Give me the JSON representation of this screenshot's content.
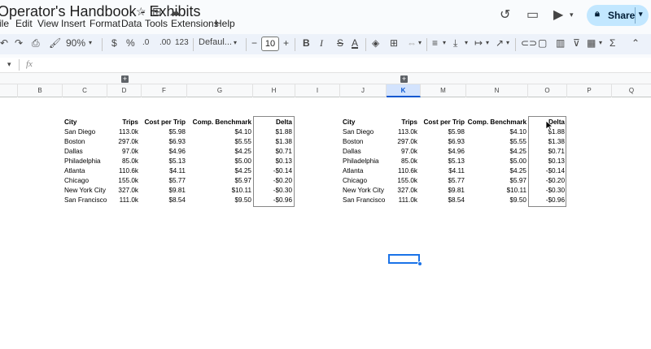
{
  "doc": {
    "title": "Operator's Handbook - Exhibits"
  },
  "menu": [
    "File",
    "Edit",
    "View",
    "Insert",
    "Format",
    "Data",
    "Tools",
    "Extensions",
    "Help"
  ],
  "menu_display": [
    "ile",
    "Edit",
    "View",
    "Insert",
    "Format",
    "Data",
    "Tools",
    "Extensions",
    "Help"
  ],
  "share": {
    "label": "Share"
  },
  "toolbar": {
    "zoom": "90%",
    "currency": "$",
    "percent": "%",
    "dec_decrease": ".0",
    "dec_increase": ".00",
    "format_123": "123",
    "font": "Defaul...",
    "font_size": "10",
    "minus": "−",
    "plus": "+",
    "bold": "B",
    "italic": "I",
    "strike": "S",
    "text_color": "A",
    "sigma": "Σ"
  },
  "formula": {
    "fx": "fx"
  },
  "columns": [
    "B",
    "C",
    "D",
    "F",
    "G",
    "H",
    "I",
    "J",
    "K",
    "M",
    "N",
    "O",
    "P",
    "Q"
  ],
  "table": {
    "headers": [
      "City",
      "Trips",
      "Cost per Trip",
      "Comp. Benchmark",
      "Delta"
    ],
    "rows": [
      [
        "San Diego",
        "113.0k",
        "$5.98",
        "$4.10",
        "$1.88"
      ],
      [
        "Boston",
        "297.0k",
        "$6.93",
        "$5.55",
        "$1.38"
      ],
      [
        "Dallas",
        "97.0k",
        "$4.96",
        "$4.25",
        "$0.71"
      ],
      [
        "Philadelphia",
        "85.0k",
        "$5.13",
        "$5.00",
        "$0.13"
      ],
      [
        "Atlanta",
        "110.6k",
        "$4.11",
        "$4.25",
        "-$0.14"
      ],
      [
        "Chicago",
        "155.0k",
        "$5.77",
        "$5.97",
        "-$0.20"
      ],
      [
        "New York City",
        "327.0k",
        "$9.81",
        "$10.11",
        "-$0.30"
      ],
      [
        "San Francisco",
        "111.0k",
        "$8.54",
        "$9.50",
        "-$0.96"
      ]
    ]
  }
}
